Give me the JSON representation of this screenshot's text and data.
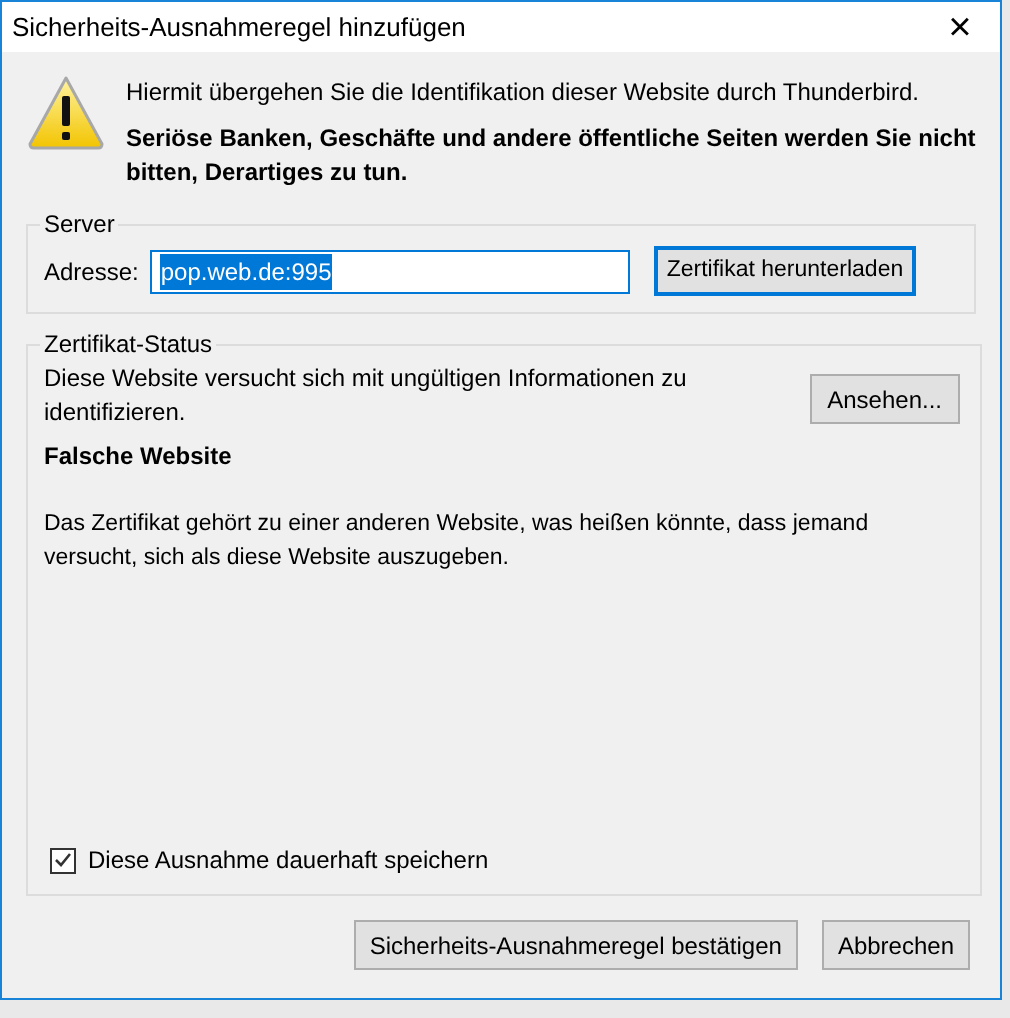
{
  "window": {
    "title": "Sicherheits-Ausnahmeregel hinzufügen",
    "close": "×"
  },
  "intro": {
    "line": "Hiermit übergehen Sie die Identifikation dieser Website durch Thunderbird.",
    "warning": "Seriöse Banken, Geschäfte und andere öffentliche Seiten werden Sie nicht bitten, Derartiges zu tun."
  },
  "server": {
    "legend": "Server",
    "address_label": "Adresse:",
    "address_value": "pop.web.de:995",
    "download_button": "Zertifikat herunterladen"
  },
  "status": {
    "legend": "Zertifikat-Status",
    "description": "Diese Website versucht sich mit ungültigen Informationen zu identifizieren.",
    "view_button": "Ansehen...",
    "heading": "Falsche Website",
    "details": "Das Zertifikat gehört zu einer anderen Website, was heißen könnte, dass jemand versucht, sich als diese Website auszugeben."
  },
  "remember": {
    "label": "Diese Ausnahme dauerhaft speichern",
    "checked": true
  },
  "buttons": [
    {
      "label": "Sicherheits-Ausnahmeregel bestätigen"
    },
    {
      "label": "Abbrechen"
    }
  ]
}
